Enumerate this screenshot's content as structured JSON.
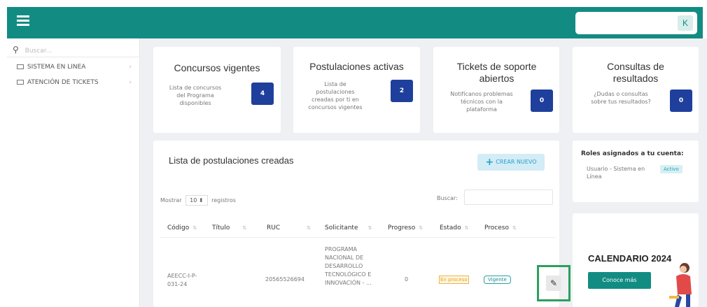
{
  "topbar": {
    "avatar_letter": "K"
  },
  "sidebar": {
    "search_placeholder": "Buscar...",
    "items": [
      {
        "label": "SISTEMA EN LINEA"
      },
      {
        "label": "ATENCIÓN DE TICKETS"
      }
    ]
  },
  "cards": [
    {
      "title": "Concursos vigentes",
      "desc": "Lista de concursos del Programa disponibles",
      "count": "4"
    },
    {
      "title": "Postulaciones activas",
      "desc": "Lista de postulaciones creadas por ti en concursos vigentes",
      "count": "2"
    },
    {
      "title": "Tickets de soporte abiertos",
      "desc": "Notifícanos problemas técnicos con la plataforma",
      "count": "0"
    },
    {
      "title": "Consultas de resultados",
      "desc": "¿Dudas o consultas sobre tus resultados?",
      "count": "0"
    }
  ],
  "list": {
    "title": "Lista de postulaciones creadas",
    "new_button": "CREAR NUEVO",
    "show_label": "Mostrar",
    "show_value": "10",
    "records_label": "registros",
    "search_label": "Buscar:",
    "columns": [
      "Código",
      "Título",
      "RUC",
      "Solicitante",
      "Progreso",
      "Estado",
      "Proceso"
    ],
    "row": {
      "codigo": "AEECC-I-P-031-24",
      "titulo": "",
      "ruc": "20565526694",
      "solicitante": "PROGRAMA NACIONAL DE DESARROLLO TECNOLÓGICO E INNOVACIÓN - ...",
      "progreso": "0",
      "estado": "En proceso",
      "proceso": "Vigente"
    }
  },
  "roles": {
    "title": "Roles asignados a tu cuenta:",
    "user_role": "Usuario - Sistema en Línea",
    "status": "Activo"
  },
  "calendar": {
    "title": "CALENDARIO 2024",
    "button": "Conoce más"
  },
  "colors": {
    "brand": "#128c82",
    "badge": "#1f3f9c",
    "highlight": "#2e9e5e"
  }
}
